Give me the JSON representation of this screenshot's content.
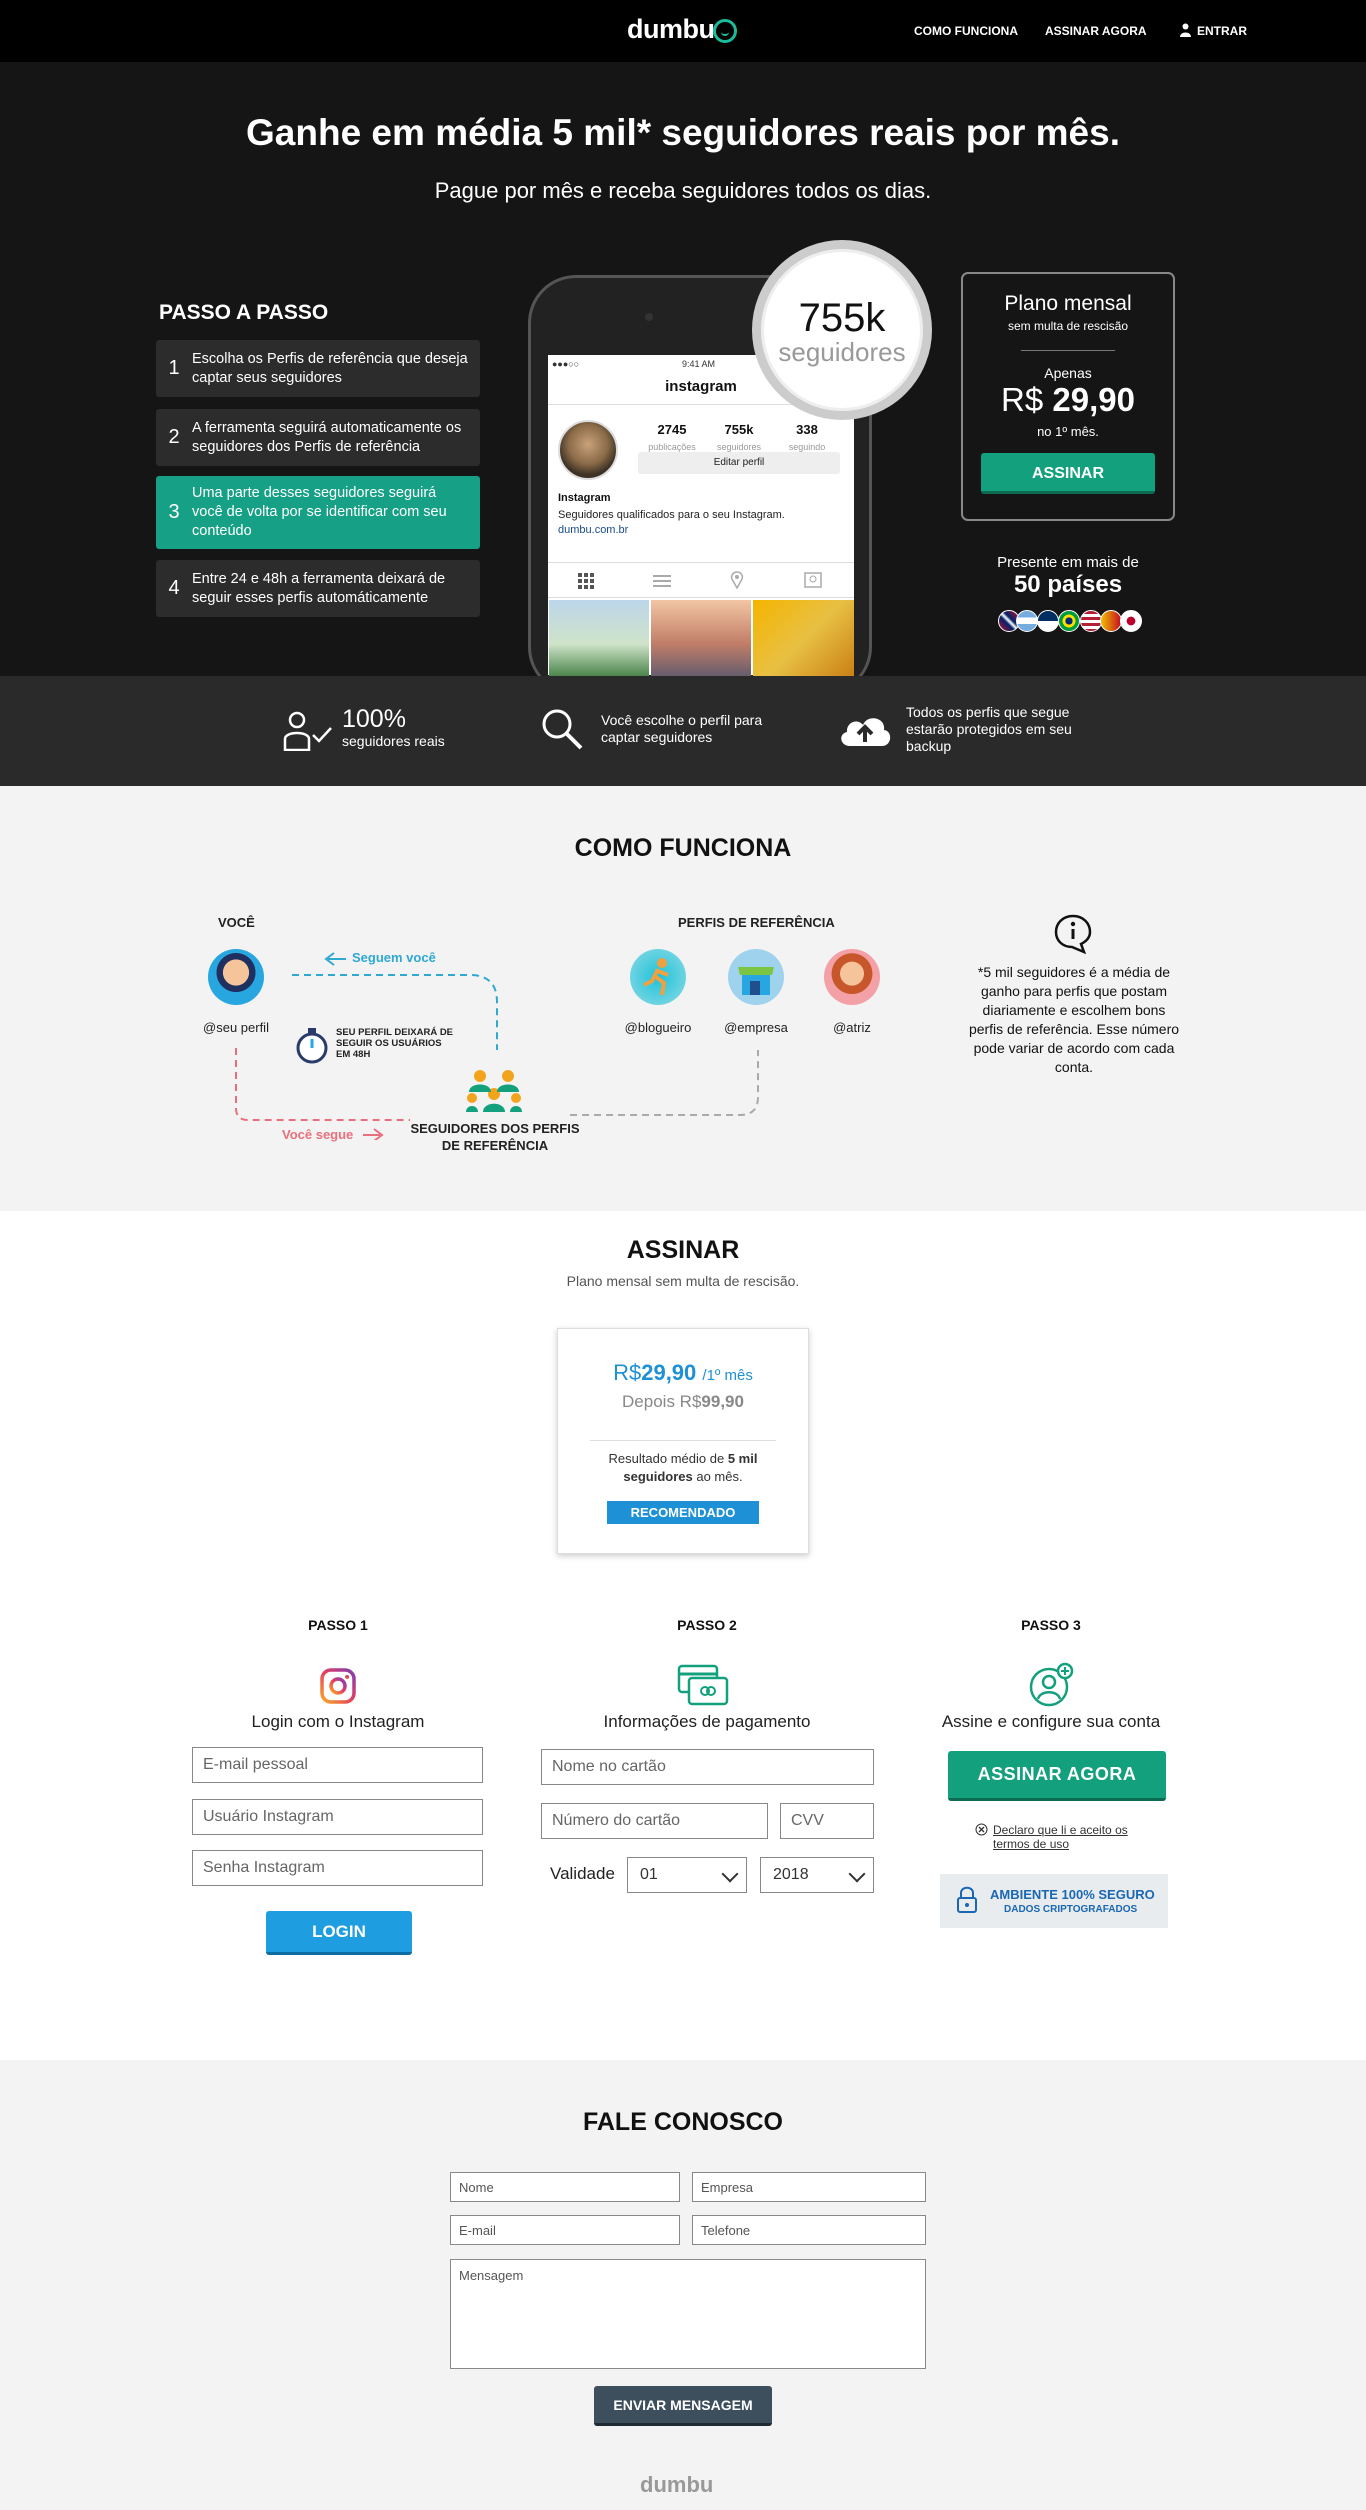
{
  "header": {
    "logo": "dumbu",
    "nav": [
      {
        "label": "COMO FUNCIONA"
      },
      {
        "label": "ASSINAR AGORA"
      },
      {
        "label": "ENTRAR",
        "icon": "user-icon"
      }
    ]
  },
  "hero": {
    "title": "Ganhe em média 5 mil* seguidores reais por mês.",
    "subtitle": "Pague por mês e receba seguidores todos os dias.",
    "steps_title": "PASSO A PASSO",
    "steps": [
      {
        "num": "1",
        "text": "Escolha os Perfis de referência que deseja captar seus seguidores"
      },
      {
        "num": "2",
        "text": "A ferramenta seguirá automaticamente os seguidores dos Perfis de referência"
      },
      {
        "num": "3",
        "text": "Uma parte desses seguidores seguirá você de volta por se identificar com seu conteúdo"
      },
      {
        "num": "4",
        "text": "Entre 24 e 48h a ferramenta deixará de seguir esses perfis automáticamente"
      }
    ],
    "phone": {
      "time": "9:41 AM",
      "username": "instagram",
      "stats": [
        {
          "value": "2745",
          "label": "publicações"
        },
        {
          "value": "755k",
          "label": "seguidores"
        },
        {
          "value": "338",
          "label": "seguindo"
        }
      ],
      "edit_label": "Editar perfil",
      "bio_name": "Instagram",
      "bio_text": "Seguidores qualificados para o seu Instagram.",
      "bio_link": "dumbu.com.br"
    },
    "badge": {
      "number": "755k",
      "label": "seguidores"
    },
    "plan": {
      "title": "Plano mensal",
      "subtitle": "sem multa de rescisão",
      "apenas": "Apenas",
      "currency": "R$",
      "price": "29,90",
      "first_month": "no 1º mês.",
      "button": "ASSINAR"
    },
    "countries": {
      "pre": "Presente em mais de",
      "count": "50 países"
    }
  },
  "features": [
    {
      "icon": "user-check-icon",
      "big": "100%",
      "text": "seguidores reais"
    },
    {
      "icon": "search-icon",
      "text": "Você escolhe o perfil para captar seguidores"
    },
    {
      "icon": "cloud-upload-icon",
      "text": "Todos os perfis que segue estarão protegidos em seu backup"
    }
  ],
  "como": {
    "title": "COMO FUNCIONA",
    "voce_label": "VOCÊ",
    "perfis_label": "PERFIS DE REFERÊNCIA",
    "seguem_voce": "Seguem você",
    "voce_segue": "Você segue",
    "timer_text": "SEU PERFIL DEIXARÁ DE SEGUIR OS USUÁRIOS EM 48H",
    "seguidores_label": "SEGUIDORES DOS PERFIS DE REFERÊNCIA",
    "handles": {
      "me": "@seu perfil",
      "blogueiro": "@blogueiro",
      "empresa": "@empresa",
      "atriz": "@atriz"
    },
    "info": "*5 mil seguidores é a média de ganho para perfis que postam diariamente e escolhem bons perfis de referência. Esse número pode variar de acordo com cada conta."
  },
  "assinar": {
    "title": "ASSINAR",
    "subtitle": "Plano mensal sem multa de rescisão.",
    "card": {
      "currency": "R$",
      "price": "29,90",
      "period": "/1º mês",
      "after_pre": "Depois R$",
      "after_price": "99,90",
      "result_pre": "Resultado médio de",
      "result_bold": "5 mil seguidores",
      "result_post": "ao mês.",
      "badge": "RECOMENDADO"
    },
    "passo1": {
      "title": "PASSO 1",
      "desc": "Login com o Instagram",
      "email_ph": "E-mail pessoal",
      "user_ph": "Usuário Instagram",
      "pass_ph": "Senha Instagram",
      "button": "LOGIN"
    },
    "passo2": {
      "title": "PASSO 2",
      "desc": "Informações de pagamento",
      "name_ph": "Nome no cartão",
      "number_ph": "Número do cartão",
      "cvv_ph": "CVV",
      "validade_label": "Validade",
      "month": "01",
      "year": "2018"
    },
    "passo3": {
      "title": "PASSO 3",
      "desc": "Assine e configure sua conta",
      "button": "ASSINAR AGORA",
      "terms": "Declaro que li e aceito os termos de uso",
      "secure_1": "AMBIENTE 100% SEGURO",
      "secure_2": "DADOS CRIPTOGRAFADOS"
    }
  },
  "fale": {
    "title": "FALE CONOSCO",
    "nome_ph": "Nome",
    "empresa_ph": "Empresa",
    "email_ph": "E-mail",
    "telefone_ph": "Telefone",
    "mensagem_ph": "Mensagem",
    "button": "ENVIAR MENSAGEM"
  },
  "footer": {
    "logo": "dumbu"
  },
  "colors": {
    "green": "#13a07c",
    "blue": "#1e90d6",
    "dark": "#151515",
    "steel": "#3d4e5c"
  }
}
